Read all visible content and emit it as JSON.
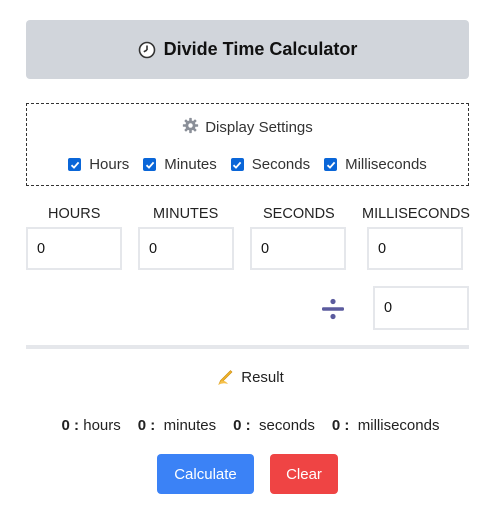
{
  "header": {
    "title": "Divide Time Calculator",
    "icon": "clock-icon"
  },
  "settings": {
    "title": "Display Settings",
    "icon": "gear-icon",
    "options": [
      {
        "label": "Hours",
        "checked": true
      },
      {
        "label": "Minutes",
        "checked": true
      },
      {
        "label": "Seconds",
        "checked": true
      },
      {
        "label": "Milliseconds",
        "checked": true
      }
    ]
  },
  "inputs": {
    "hours": {
      "label": "HOURS",
      "value": "0"
    },
    "minutes": {
      "label": "MINUTES",
      "value": "0"
    },
    "seconds": {
      "label": "SECONDS",
      "value": "0"
    },
    "milliseconds": {
      "label": "MILLISECONDS",
      "value": "0"
    }
  },
  "divisor": {
    "icon": "divide-icon",
    "value": "0"
  },
  "result": {
    "title": "Result",
    "icon": "writing-hand-icon",
    "hours_value": "0 :",
    "hours_unit": "hours",
    "minutes_value": "0 :",
    "minutes_unit": "minutes",
    "seconds_value": "0 :",
    "seconds_unit": "seconds",
    "milliseconds_value": "0 :",
    "milliseconds_unit": "milliseconds"
  },
  "buttons": {
    "calculate": "Calculate",
    "clear": "Clear"
  },
  "colors": {
    "header_bg": "#d1d5db",
    "calculate": "#3b82f6",
    "clear": "#ef4444",
    "checkbox": "#0a66d8",
    "divide_icon": "#5b5b9e"
  }
}
